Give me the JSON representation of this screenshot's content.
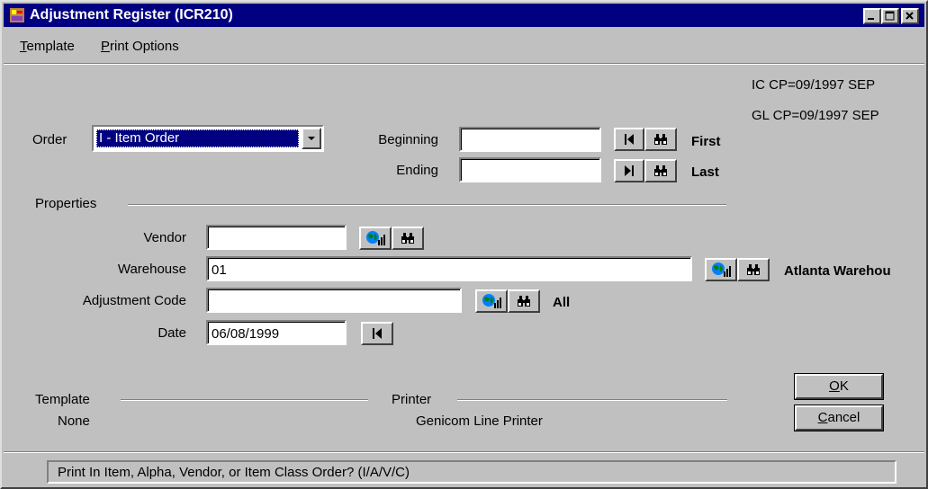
{
  "window": {
    "title": "Adjustment Register (ICR210)",
    "title_bar_color": "#000080"
  },
  "menu": {
    "template": {
      "prefix": "",
      "accel": "T",
      "rest": "emplate"
    },
    "print_options": {
      "prefix": "",
      "accel": "P",
      "rest": "rint Options"
    }
  },
  "periods": {
    "ic": "IC CP=09/1997 SEP",
    "gl": "GL CP=09/1997 SEP"
  },
  "order": {
    "label": "Order",
    "selected": "I - Item Order"
  },
  "range": {
    "beginning_label": "Beginning",
    "beginning_value": "",
    "beginning_hint": "First",
    "ending_label": "Ending",
    "ending_value": "",
    "ending_hint": "Last"
  },
  "properties": {
    "title": "Properties",
    "vendor_label": "Vendor",
    "vendor_value": "",
    "warehouse_label": "Warehouse",
    "warehouse_value": "01",
    "warehouse_name": "Atlanta Warehou",
    "adjustment_code_label": "Adjustment Code",
    "adjustment_code_value": "",
    "adjustment_code_desc": "All",
    "date_label": "Date",
    "date_value": "06/08/1999"
  },
  "template_group": {
    "title": "Template",
    "value": "None"
  },
  "printer_group": {
    "title": "Printer",
    "value": "Genicom Line Printer"
  },
  "buttons": {
    "ok": {
      "accel": "O",
      "rest": "K"
    },
    "cancel": {
      "accel": "C",
      "rest": "ancel"
    }
  },
  "status": "Print In Item, Alpha, Vendor, or Item Class Order? (I/A/V/C)",
  "icons": {
    "first": "first-record-icon",
    "last": "last-record-icon",
    "search": "binoculars-icon",
    "lookup": "globe-lookup-icon"
  }
}
